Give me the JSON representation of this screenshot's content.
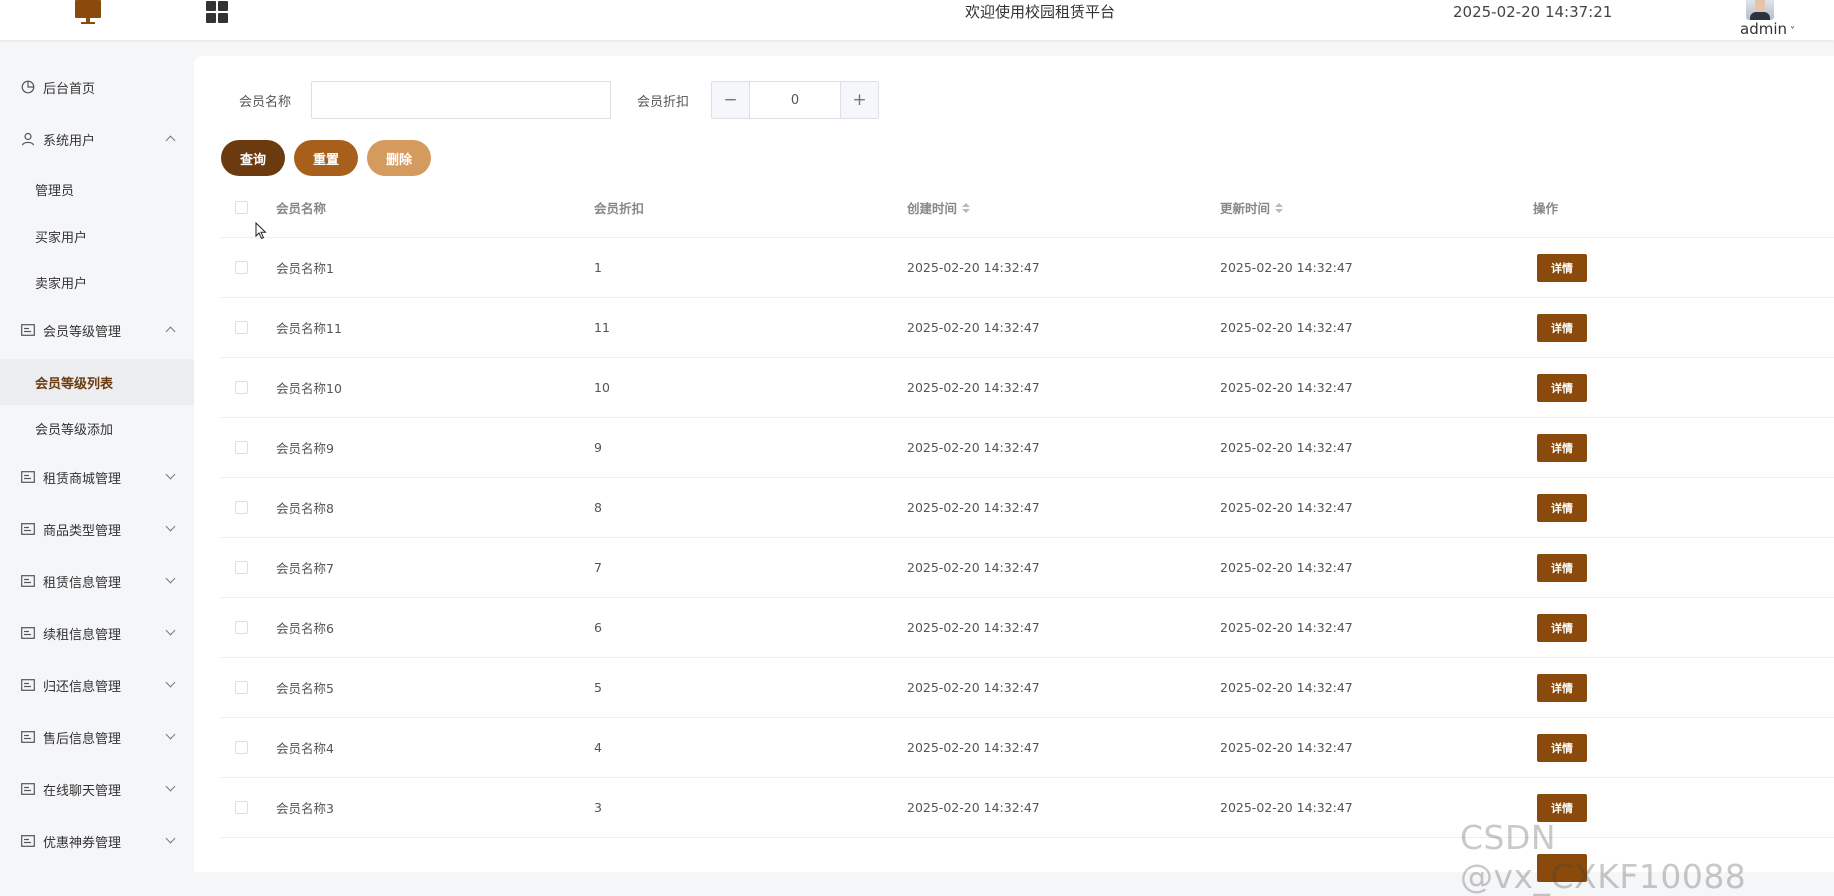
{
  "header": {
    "title": "欢迎使用校园租赁平台",
    "datetime": "2025-02-20 14:37:21",
    "user": "admin"
  },
  "sidebar": {
    "items": [
      {
        "label": "后台首页",
        "icon": "pie-chart-icon"
      },
      {
        "label": "系统用户",
        "icon": "user-icon",
        "expanded": true
      },
      {
        "label": "管理员",
        "sub": true
      },
      {
        "label": "买家用户",
        "sub": true
      },
      {
        "label": "卖家用户",
        "sub": true
      },
      {
        "label": "会员等级管理",
        "icon": "menu-icon",
        "expanded": true
      },
      {
        "label": "会员等级列表",
        "sub": true,
        "active": true
      },
      {
        "label": "会员等级添加",
        "sub": true
      },
      {
        "label": "租赁商城管理",
        "icon": "menu-icon"
      },
      {
        "label": "商品类型管理",
        "icon": "menu-icon"
      },
      {
        "label": "租赁信息管理",
        "icon": "menu-icon"
      },
      {
        "label": "续租信息管理",
        "icon": "menu-icon"
      },
      {
        "label": "归还信息管理",
        "icon": "menu-icon"
      },
      {
        "label": "售后信息管理",
        "icon": "menu-icon"
      },
      {
        "label": "在线聊天管理",
        "icon": "menu-icon"
      },
      {
        "label": "优惠神券管理",
        "icon": "menu-icon"
      }
    ]
  },
  "search": {
    "name_label": "会员名称",
    "name_value": "",
    "discount_label": "会员折扣",
    "discount_value": "0",
    "minus": "−",
    "plus": "+"
  },
  "actions": {
    "query": "查询",
    "reset": "重置",
    "delete": "删除"
  },
  "colors": {
    "query": "#6b3a0e",
    "reset": "#a85f1c",
    "delete": "#d59a5e",
    "detail": "#8a4a0c"
  },
  "table": {
    "columns": [
      "会员名称",
      "会员折扣",
      "创建时间",
      "更新时间",
      "操作"
    ],
    "action_label": "详情",
    "rows": [
      {
        "name": "会员名称1",
        "discount": "1",
        "created": "2025-02-20 14:32:47",
        "updated": "2025-02-20 14:32:47"
      },
      {
        "name": "会员名称11",
        "discount": "11",
        "created": "2025-02-20 14:32:47",
        "updated": "2025-02-20 14:32:47"
      },
      {
        "name": "会员名称10",
        "discount": "10",
        "created": "2025-02-20 14:32:47",
        "updated": "2025-02-20 14:32:47"
      },
      {
        "name": "会员名称9",
        "discount": "9",
        "created": "2025-02-20 14:32:47",
        "updated": "2025-02-20 14:32:47"
      },
      {
        "name": "会员名称8",
        "discount": "8",
        "created": "2025-02-20 14:32:47",
        "updated": "2025-02-20 14:32:47"
      },
      {
        "name": "会员名称7",
        "discount": "7",
        "created": "2025-02-20 14:32:47",
        "updated": "2025-02-20 14:32:47"
      },
      {
        "name": "会员名称6",
        "discount": "6",
        "created": "2025-02-20 14:32:47",
        "updated": "2025-02-20 14:32:47"
      },
      {
        "name": "会员名称5",
        "discount": "5",
        "created": "2025-02-20 14:32:47",
        "updated": "2025-02-20 14:32:47"
      },
      {
        "name": "会员名称4",
        "discount": "4",
        "created": "2025-02-20 14:32:47",
        "updated": "2025-02-20 14:32:47"
      },
      {
        "name": "会员名称3",
        "discount": "3",
        "created": "2025-02-20 14:32:47",
        "updated": "2025-02-20 14:32:47"
      }
    ]
  },
  "watermark": "CSDN @vx_CXKF10088"
}
